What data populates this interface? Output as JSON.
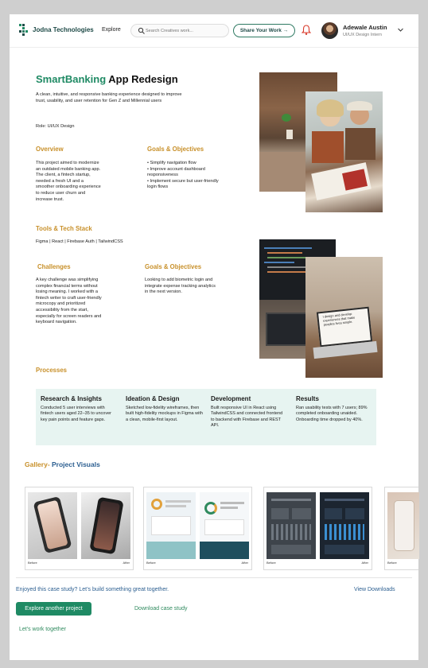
{
  "header": {
    "brand": "Jodna Technologies",
    "nav_explore": "Explore",
    "search_placeholder": "Search Creatives work...",
    "share_button": "Share Your Work →",
    "user_name": "Adewale Austin",
    "user_role": "UI/UX Design Intern"
  },
  "project": {
    "title_accent": "SmartBanking",
    "title_rest": " App Redesign",
    "description": "A clean, intuitive, and responsive banking experience designed to improve trust, usability, and user retention for Gen Z and Millennial users",
    "role": "Role: UI/UX Design",
    "overview_heading": "Overview",
    "overview_text": "This project aimed to modernize an outdated mobile banking app. The client, a fintech startup, needed a fresh UI and a smoother onboarding experience to reduce user churn and increase trust.",
    "goals_heading": "Goals & Objectives",
    "goals_items": [
      "• Simplify navigation flow",
      "• Improve account dashboard responsiveness",
      "• Implement secure but user-friendly login flows"
    ],
    "tools_heading": "Tools & Tech Stack",
    "tools_text": "Figma | React | Firebase Auth | TailwindCSS",
    "challenges_heading": "Challenges",
    "challenges_text": "A key challenge was simplifying complex financial terms without losing meaning. I worked with a fintech writer to craft user-friendly microcopy and prioritized accessibility from the start, especially for screen readers and keyboard navigation.",
    "goals2_heading": "Goals & Objectives",
    "goals2_text": "Looking to add biometric login and integrate expense tracking analytics in the next version.",
    "processes_heading": "Processes",
    "photo_text": "I design and develop experiences that make peoples lives simple."
  },
  "processes": [
    {
      "title": "Research & Insights",
      "text": "Conducted 5 user interviews with fintech users aged 22–35 to uncover key pain points and feature gaps."
    },
    {
      "title": "Ideation & Design",
      "text": "Sketched low-fidelity wireframes, then built high-fidelity mockups in Figma with a clean, mobile-first layout."
    },
    {
      "title": "Development",
      "text": "Built responsive UI in React using TailwindCSS and connected frontend to backend with Firebase and REST API."
    },
    {
      "title": "Results",
      "text": "Ran usability tests with 7 users; 89% completed onboarding unaided. Onboarding time dropped by 40%."
    }
  ],
  "gallery": {
    "title_a": "Gallery-",
    "title_b": " Project Visuals",
    "before_label": "Before",
    "after_label": "After"
  },
  "footer": {
    "cta_text": "Enjoyed this case study? Let’s build something great together.",
    "view_downloads": "View Downloads",
    "explore_button": "Explore another project",
    "download_case": "Download case study",
    "lets_work": "Let's work together"
  }
}
